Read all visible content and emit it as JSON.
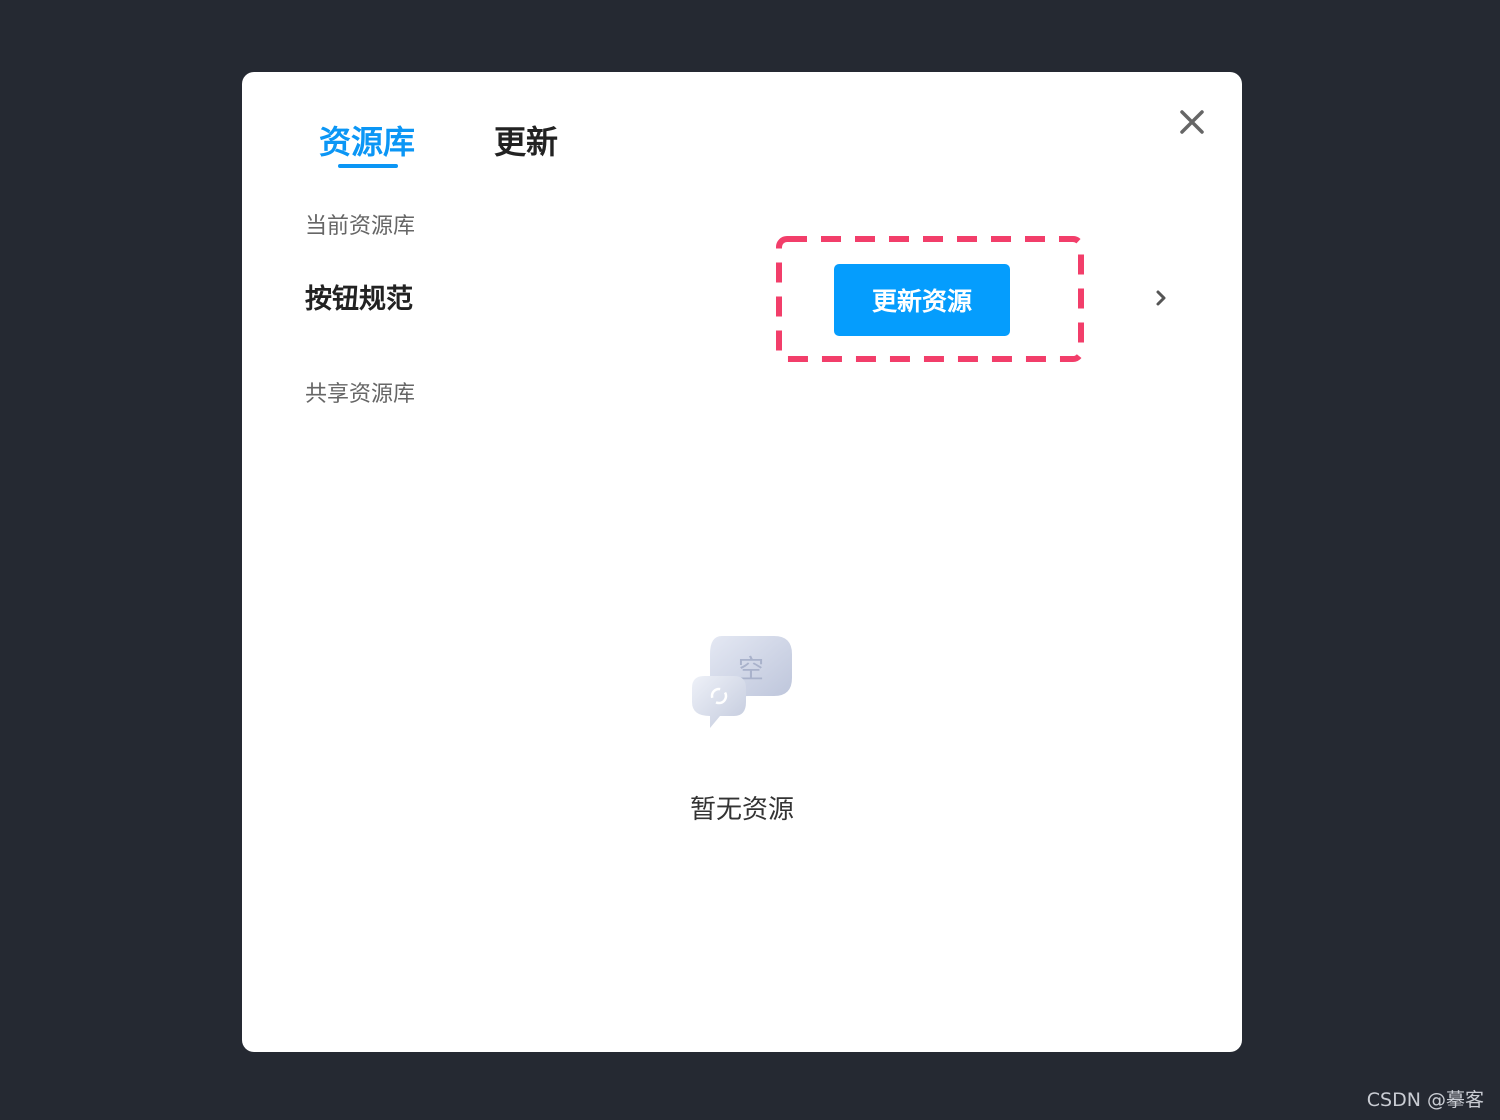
{
  "dialog": {
    "tabs": [
      {
        "label": "资源库",
        "active": true
      },
      {
        "label": "更新",
        "active": false
      }
    ],
    "current_library": {
      "section_label": "当前资源库",
      "name": "按钮规范",
      "update_button_label": "更新资源"
    },
    "shared_library": {
      "section_label": "共享资源库"
    },
    "empty_state": {
      "illustration_glyph": "空",
      "text": "暂无资源"
    },
    "icons": {
      "close": "close-icon",
      "expand": "chevron-right-icon",
      "empty": "empty-chat-bubbles-icon"
    }
  },
  "watermark": "CSDN @摹客",
  "colors": {
    "background": "#252932",
    "dialog": "#ffffff",
    "accent": "#0b96f5",
    "button": "#059dfd",
    "highlight_dash": "#f23e6a"
  }
}
